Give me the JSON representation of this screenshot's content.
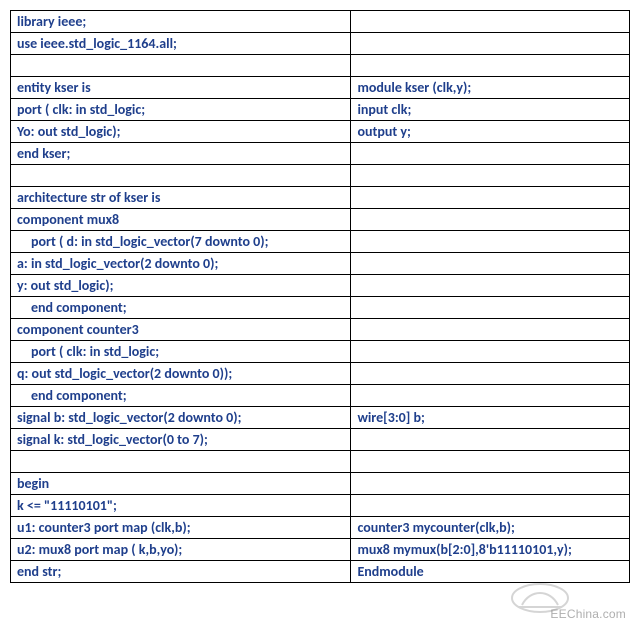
{
  "rows": [
    {
      "left": "library ieee;",
      "right": ""
    },
    {
      "left": "use ieee.std_logic_1164.all;",
      "right": ""
    },
    {
      "left": "",
      "right": ""
    },
    {
      "left": "entity kser is",
      "right": "module kser (clk,y);"
    },
    {
      "left": "port ( clk: in std_logic;",
      "right": "input clk;"
    },
    {
      "left": "Yo: out std_logic);",
      "right": "output y;"
    },
    {
      "left": "end kser;",
      "right": ""
    },
    {
      "left": "",
      "right": ""
    },
    {
      "left": "architecture str of kser is",
      "right": ""
    },
    {
      "left": "component mux8",
      "right": ""
    },
    {
      "left": "port ( d: in std_logic_vector(7 downto 0);",
      "indent": true,
      "right": ""
    },
    {
      "left": "a: in std_logic_vector(2 downto 0);",
      "right": ""
    },
    {
      "left": "y: out std_logic);",
      "right": ""
    },
    {
      "left": "end component;",
      "indent": true,
      "right": ""
    },
    {
      "left": "component counter3",
      "right": ""
    },
    {
      "left": "port ( clk: in std_logic;",
      "indent": true,
      "right": ""
    },
    {
      "left": "q: out std_logic_vector(2 downto 0));",
      "right": ""
    },
    {
      "left": "end component;",
      "indent": true,
      "right": ""
    },
    {
      "left": "signal b: std_logic_vector(2 downto 0);",
      "right": "wire[3:0] b;"
    },
    {
      "left": "signal k: std_logic_vector(0 to 7);",
      "right": ""
    },
    {
      "left": "",
      "right": ""
    },
    {
      "left": "begin",
      "right": ""
    },
    {
      "left": "k <= \"11110101\";",
      "right": ""
    },
    {
      "left": "u1: counter3 port map (clk,b);",
      "right": "counter3 mycounter(clk,b);"
    },
    {
      "left": "u2: mux8 port map ( k,b,yo);",
      "right": "mux8 mymux(b[2:0],8'b11110101,y);"
    },
    {
      "left": "end str;",
      "right": "Endmodule"
    }
  ],
  "watermark": "EEChina.com"
}
